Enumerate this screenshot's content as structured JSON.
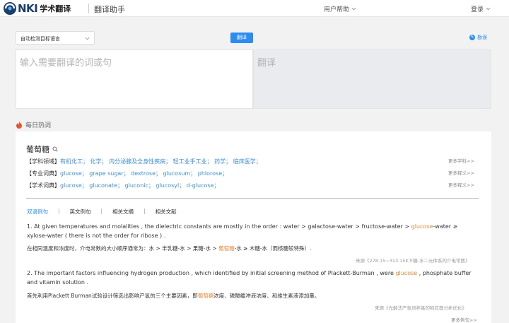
{
  "header": {
    "logo_letters": "NKI",
    "logo_text": "学术翻译",
    "app_title": "翻译助手",
    "help_label": "用户帮助",
    "login_label": "登录"
  },
  "translator": {
    "lang_select_value": "自动检测目标语言",
    "translate_button": "翻译",
    "feedback_label": "勘误",
    "source_placeholder": "输入需要翻译的词或句",
    "target_placeholder": "翻译"
  },
  "hot": {
    "heading": "每日热词",
    "word": "葡萄糖",
    "rows": [
      {
        "tag": "【学科领域】",
        "values": "有机化工； 化学； 内分泌腺及全身性疾病； 轻工业手工业； 药学； 临床医学；",
        "more": "更多学科>>"
      },
      {
        "tag": "【专业词典】",
        "values": "glucose； grape sugar； dextrose； glucosum； phlorose；",
        "more": "更多释义>>"
      },
      {
        "tag": "【学术词典】",
        "values": "glucose； gluconate； gluconic； glucosyl； d-glucose；",
        "more": "更多释义>>"
      }
    ],
    "tabs": [
      "双语例句",
      "英文例句",
      "相关文摘",
      "相关文献"
    ],
    "tab_separator": "|",
    "examples": [
      {
        "en_before": "1. At given temperatures and molalities , the dielectric constants are mostly in the order : water > galactose-water > fructose-water > ",
        "en_highlight": "glucose",
        "en_after": "-water ≥ xylose-water ( there is not the order for ribose ) .",
        "zh_before": "在相同温度和浓度时，介电常数的大小顺序通常为：水 > 半乳糖-水 > 果糖-水 > ",
        "zh_highlight": "葡萄糖",
        "zh_after": "-水 ≥ 木糖-水（而核糖较特殊）.",
        "source": "来源《278.15~313.15K下糖-水二元体系的介电常数》"
      },
      {
        "en_before": "2. The important factors influencing hydrogen production , which identified by initial screening method of Plackett-Burman , were ",
        "en_highlight": "glucose",
        "en_after": " , phosphate buffer and vitamin solution .",
        "zh_before": "首先利用Plackett Burman试验设计筛选出影响产氢的三个主要因素，即",
        "zh_highlight": "葡萄糖",
        "zh_after": "浓度、磷酸缓冲液浓度、和维生素液添加量。",
        "source": "来源《光解法产氢培养基的响应面分析优化》"
      }
    ],
    "more_examples": "更多例句>>"
  },
  "colors": {
    "accent": "#2d8cf0",
    "link": "#3b8fd8",
    "highlight": "#e8893a",
    "logo": "#1a3e6e"
  }
}
